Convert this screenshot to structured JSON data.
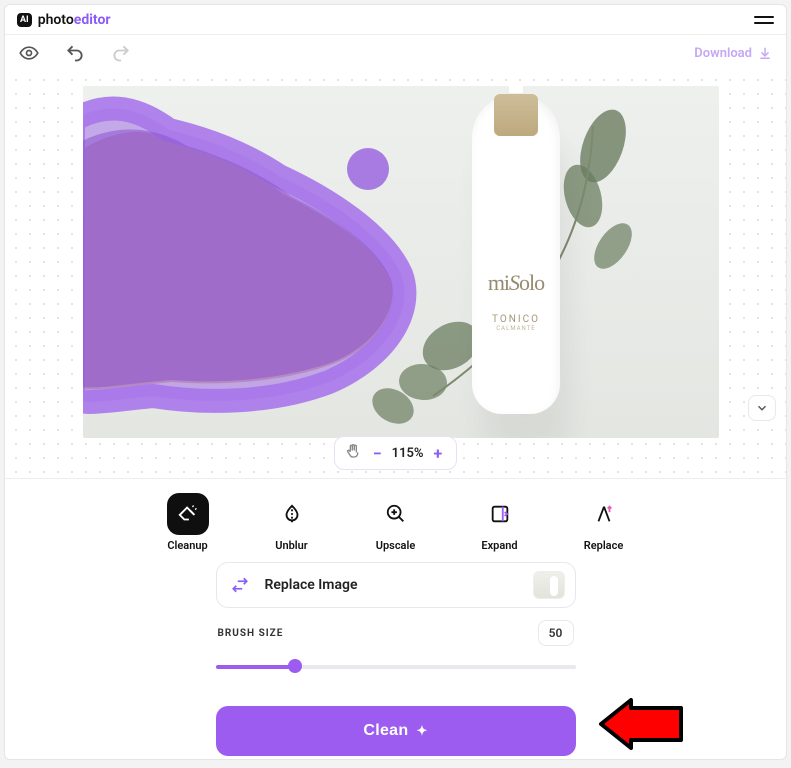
{
  "app": {
    "logo_badge": "AI",
    "logo_text1": "photo",
    "logo_text2": "editor"
  },
  "toolbar": {
    "download": "Download"
  },
  "zoom": {
    "level": "115%"
  },
  "image": {
    "brand": "miSolo",
    "sub1": "TONICO",
    "sub2": "CALMANTE"
  },
  "mask_color": "rgba(155,102,224,0.72)",
  "tools": [
    {
      "id": "cleanup",
      "label": "Cleanup",
      "active": true
    },
    {
      "id": "unblur",
      "label": "Unblur",
      "active": false
    },
    {
      "id": "upscale",
      "label": "Upscale",
      "active": false
    },
    {
      "id": "expand",
      "label": "Expand",
      "active": false
    },
    {
      "id": "replace",
      "label": "Replace",
      "active": false
    }
  ],
  "panel": {
    "replace_label": "Replace Image",
    "brush_label": "BRUSH SIZE",
    "brush_value": "50",
    "clean_label": "Clean"
  }
}
